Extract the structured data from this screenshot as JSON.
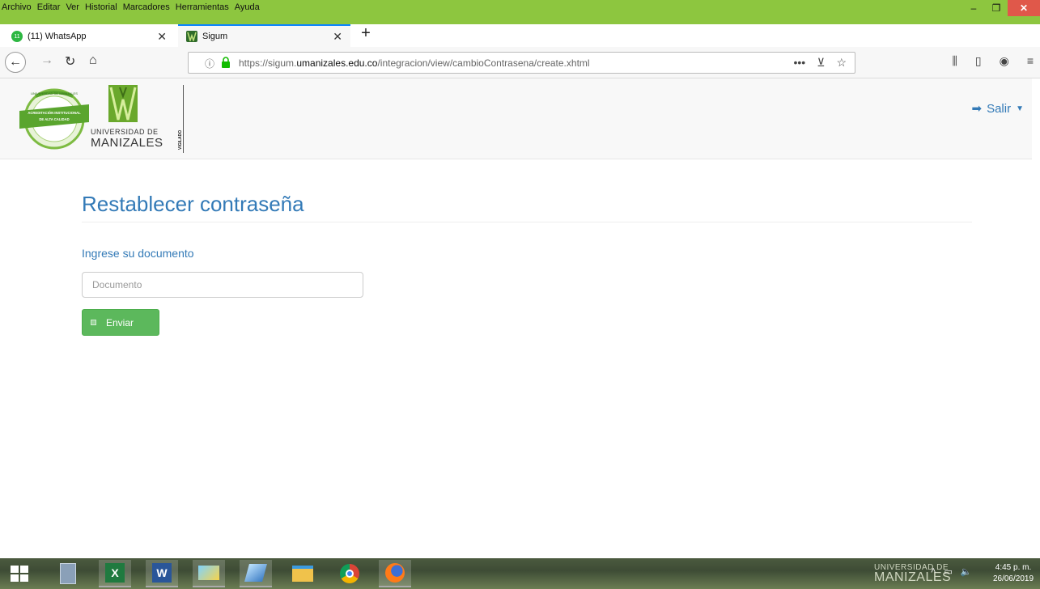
{
  "browser": {
    "menu": [
      "Archivo",
      "Editar",
      "Ver",
      "Historial",
      "Marcadores",
      "Herramientas",
      "Ayuda"
    ],
    "tabs": [
      {
        "title": "(11) WhatsApp",
        "badge": "11"
      },
      {
        "title": "Sigum"
      }
    ],
    "url_prefix": "https://sigum.",
    "url_domain": "umanizales.edu.co",
    "url_path": "/integracion/view/cambioContrasena/create.xhtml"
  },
  "header": {
    "logo_line1": "UNIVERSIDAD DE",
    "logo_line2": "MANIZALES",
    "seal_top": "UNIVERSIDAD DE MANIZALES",
    "seal_ribbon1": "ACREDITACIÓN INSTITUCIONAL",
    "seal_ribbon2": "DE ALTA CALIDAD",
    "vigilado": "VIGILADO",
    "salir": "Salir"
  },
  "form": {
    "title": "Restablecer contraseña",
    "label": "Ingrese su documento",
    "placeholder": "Documento",
    "submit": "Enviar"
  },
  "taskbar": {
    "logo_line1": "UNIVERSIDAD DE",
    "logo_line2": "MANIZALES",
    "time": "4:45 p. m.",
    "date": "26/06/2019"
  },
  "colors": {
    "menubar": "#8dc63f",
    "link_blue": "#337ab7",
    "button_green": "#5cb85c"
  }
}
